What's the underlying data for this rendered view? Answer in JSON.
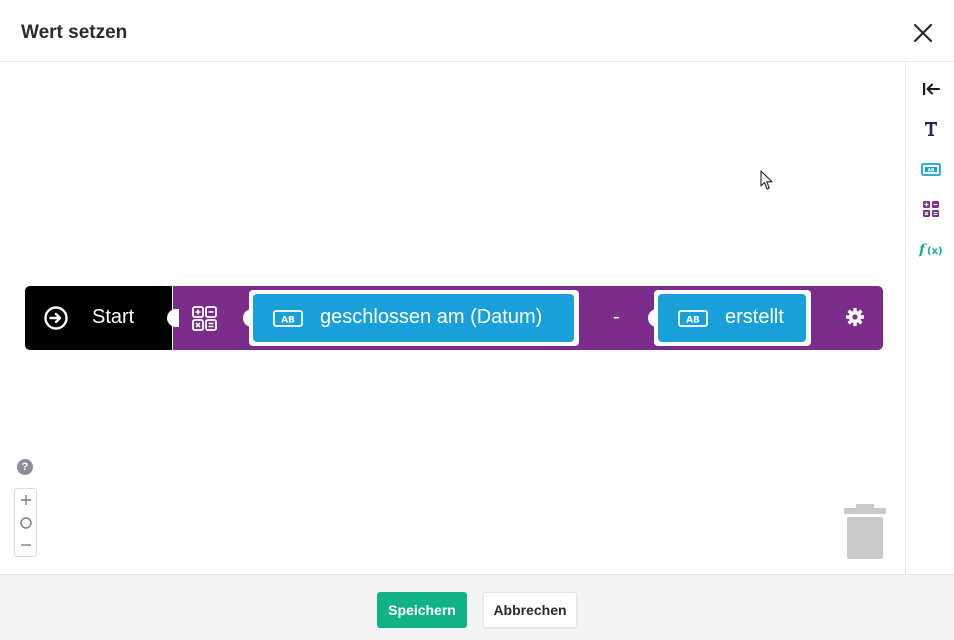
{
  "dialog": {
    "title": "Wert setzen"
  },
  "toolbox": {
    "items": [
      "collapse-left-icon",
      "text-icon",
      "ab-text-icon",
      "calculator-icon",
      "function-icon"
    ]
  },
  "blocks": {
    "start_label": "Start",
    "left_value": "geschlossen am (Datum)",
    "operator": "-",
    "right_value": "erstellt"
  },
  "zoom": {
    "help": "?",
    "plus": "+",
    "reset": "○",
    "minus": "−"
  },
  "footer": {
    "save_label": "Speichern",
    "cancel_label": "Abbrechen"
  },
  "colors": {
    "start_block": "#000000",
    "calc_block": "#7b2d8b",
    "value_block": "#1aa0d8",
    "save_button": "#12b289",
    "text_tool": "#1c2a4a",
    "ab_tool": "#1aa0d8",
    "calc_tool": "#7b2d8b",
    "function_tool": "#12b289"
  }
}
